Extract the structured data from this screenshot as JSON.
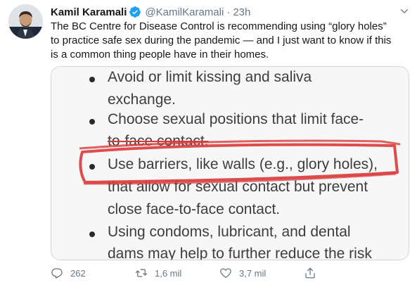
{
  "author": {
    "name": "Kamil Karamali",
    "handle": "@KamilKaramali",
    "separator": "·",
    "time": "23h"
  },
  "tweet": {
    "text": "The BC Centre for Disease Control is recommending using “glory holes”\nto practice safe sex during the pandemic — and I just want to know if this\nis a common thing people have in their homes."
  },
  "media": {
    "lines": [
      "Avoid or limit kissing and saliva",
      "exchange.",
      "Choose sexual positions that limit face-",
      "to-face contact.",
      "Use barriers, like walls (e.g., glory holes),",
      "that allow for sexual contact but prevent",
      "close face-to-face contact.",
      "Using condoms, lubricant, and dental",
      "dams may help to further reduce the risk"
    ]
  },
  "actions": {
    "replies": "262",
    "retweets": "1,6 mil",
    "likes": "3,7 mil"
  },
  "colors": {
    "verified": "#1da1f2",
    "marker_red": "#d93a3a",
    "muted": "#657786"
  },
  "icons": {
    "verified": "verified-badge-icon",
    "chevron": "chevron-down-icon",
    "reply": "reply-icon",
    "retweet": "retweet-icon",
    "like": "heart-icon",
    "share": "share-icon"
  }
}
